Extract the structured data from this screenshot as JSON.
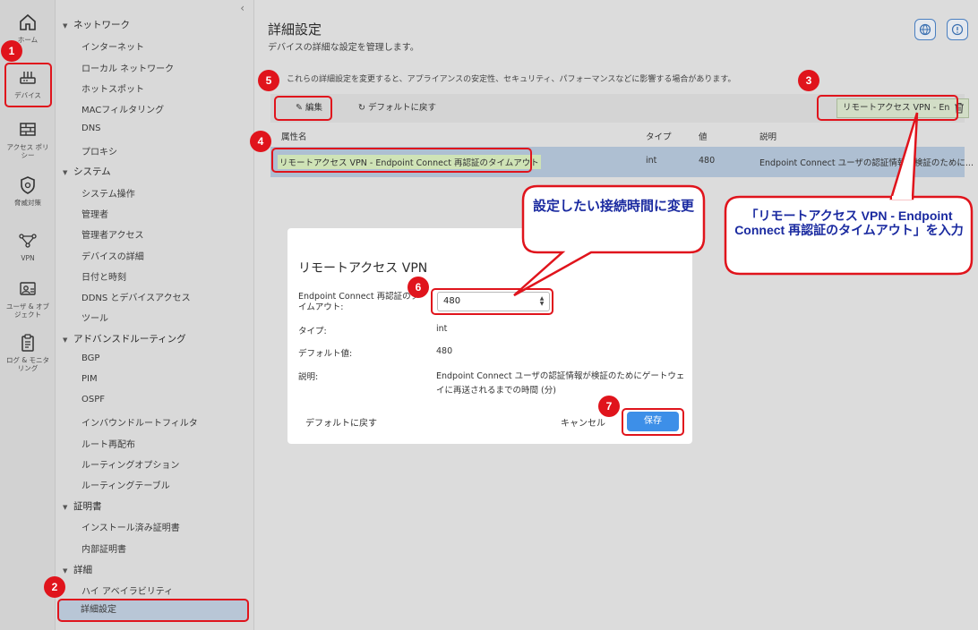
{
  "rail": {
    "items": [
      {
        "label": "ホーム",
        "icon": "home-icon"
      },
      {
        "label": "デバイス",
        "icon": "device-icon"
      },
      {
        "label": "アクセス ポリシー",
        "icon": "firewall-icon"
      },
      {
        "label": "脅威対策",
        "icon": "shield-icon"
      },
      {
        "label": "VPN",
        "icon": "vpn-icon"
      },
      {
        "label": "ユーザ & オブジェクト",
        "icon": "user-object-icon"
      },
      {
        "label": "ログ & モニタリング",
        "icon": "clipboard-icon"
      }
    ]
  },
  "nav": {
    "collapse": "‹",
    "sections": [
      {
        "title": "ネットワーク",
        "items": [
          "インターネット",
          "ローカル ネットワーク",
          "ホットスポット",
          "MACフィルタリング",
          "DNS",
          "プロキシ"
        ]
      },
      {
        "title": "システム",
        "items": [
          "システム操作",
          "管理者",
          "管理者アクセス",
          "デバイスの詳細",
          "日付と時刻",
          "DDNS とデバイスアクセス",
          "ツール"
        ]
      },
      {
        "title": "アドバンスドルーティング",
        "items": [
          "BGP",
          "PIM",
          "OSPF",
          "インバウンドルートフィルタ",
          "ルート再配布",
          "ルーティングオプション",
          "ルーティングテーブル"
        ]
      },
      {
        "title": "証明書",
        "items": [
          "インストール済み証明書",
          "内部証明書"
        ]
      },
      {
        "title": "詳細",
        "items": [
          "ハイ アベイラビリティ",
          "詳細設定"
        ]
      }
    ]
  },
  "main": {
    "title": "詳細設定",
    "subtitle": "デバイスの詳細な設定を管理します。",
    "warning": "これらの詳細設定を変更すると、アプライアンスの安定性、セキュリティ、パフォーマンスなどに影響する場合があります。",
    "toolbar": {
      "edit": "編集",
      "reset": "デフォルトに戻す",
      "search_value": "リモートアクセス VPN - En"
    },
    "table": {
      "headers": [
        "属性名",
        "タイプ",
        "値",
        "説明"
      ],
      "row": {
        "name": "リモートアクセス VPN - Endpoint Connect 再認証のタイムアウト",
        "type": "int",
        "value": "480",
        "description": "Endpoint Connect ユーザの認証情報が検証のために..."
      }
    }
  },
  "modal": {
    "title": "リモートアクセス VPN",
    "field_label": "Endpoint Connect 再認証のタイムアウト:",
    "field_value": "480",
    "type_label": "タイプ:",
    "type_value": "int",
    "default_label": "デフォルト値:",
    "default_value": "480",
    "desc_label": "説明:",
    "desc_value": "Endpoint Connect ユーザの認証情報が検証のためにゲートウェイに再送されるまでの時間 (分)",
    "reset": "デフォルトに戻す",
    "cancel": "キャンセル",
    "save": "保存"
  },
  "annotations": {
    "badges": [
      "1",
      "2",
      "3",
      "4",
      "5",
      "6",
      "7"
    ],
    "callout_change": "設定したい接続時間に変更",
    "callout_input": "「リモートアクセス VPN - Endpoint Connect 再認証のタイムアウト」を入力"
  },
  "colors": {
    "annotation_red": "#e0141c",
    "callout_text": "#1a2aa0",
    "save_blue": "#3d8fe8",
    "selected_row": "#aebfd2"
  }
}
